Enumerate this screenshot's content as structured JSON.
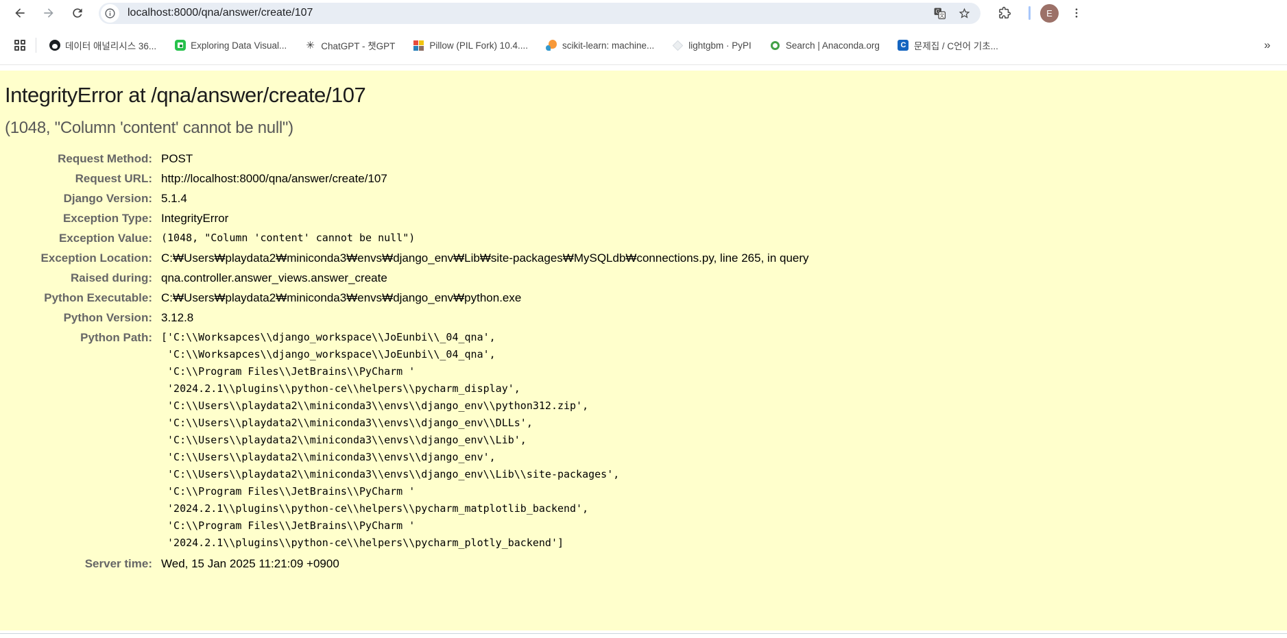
{
  "browser": {
    "url": "localhost:8000/qna/answer/create/107",
    "profile_initial": "E"
  },
  "bookmarks": {
    "overflow_chevron": "»",
    "items": [
      {
        "icon": "github-icon",
        "label": "데이터 애널리시스 36..."
      },
      {
        "icon": "data-visual-icon",
        "label": "Exploring Data Visual..."
      },
      {
        "icon": "chatgpt-icon",
        "label": "ChatGPT - 챗GPT"
      },
      {
        "icon": "pillow-icon",
        "label": "Pillow (PIL Fork) 10.4...."
      },
      {
        "icon": "scikit-learn-icon",
        "label": "scikit-learn: machine..."
      },
      {
        "icon": "lightgbm-icon",
        "label": "lightgbm · PyPI"
      },
      {
        "icon": "anaconda-icon",
        "label": "Search | Anaconda.org"
      },
      {
        "icon": "c-lang-icon",
        "label": "문제집 / C언어 기초..."
      }
    ]
  },
  "page": {
    "title": "IntegrityError at /qna/answer/create/107",
    "subtitle": "(1048, \"Column 'content' cannot be null\")",
    "summary_bg": "#ffffcc",
    "meta": {
      "rows": [
        {
          "label": "Request Method:",
          "value": "POST"
        },
        {
          "label": "Request URL:",
          "value": "http://localhost:8000/qna/answer/create/107"
        },
        {
          "label": "Django Version:",
          "value": "5.1.4"
        },
        {
          "label": "Exception Type:",
          "value": "IntegrityError"
        },
        {
          "label": "Exception Value:",
          "value": "(1048, \"Column 'content' cannot be null\")"
        },
        {
          "label": "Exception Location:",
          "value": "C:₩Users₩playdata2₩miniconda3₩envs₩django_env₩Lib₩site-packages₩MySQLdb₩connections.py, line 265, in query"
        },
        {
          "label": "Raised during:",
          "value": "qna.controller.answer_views.answer_create"
        },
        {
          "label": "Python Executable:",
          "value": "C:₩Users₩playdata2₩miniconda3₩envs₩django_env₩python.exe"
        },
        {
          "label": "Python Version:",
          "value": "3.12.8"
        },
        {
          "label": "Python Path:",
          "value": "['C:\\\\Worksapces\\\\django_workspace\\\\JoEunbi\\\\_04_qna',\n 'C:\\\\Worksapces\\\\django_workspace\\\\JoEunbi\\\\_04_qna',\n 'C:\\\\Program Files\\\\JetBrains\\\\PyCharm '\n '2024.2.1\\\\plugins\\\\python-ce\\\\helpers\\\\pycharm_display',\n 'C:\\\\Users\\\\playdata2\\\\miniconda3\\\\envs\\\\django_env\\\\python312.zip',\n 'C:\\\\Users\\\\playdata2\\\\miniconda3\\\\envs\\\\django_env\\\\DLLs',\n 'C:\\\\Users\\\\playdata2\\\\miniconda3\\\\envs\\\\django_env\\\\Lib',\n 'C:\\\\Users\\\\playdata2\\\\miniconda3\\\\envs\\\\django_env',\n 'C:\\\\Users\\\\playdata2\\\\miniconda3\\\\envs\\\\django_env\\\\Lib\\\\site-packages',\n 'C:\\\\Program Files\\\\JetBrains\\\\PyCharm '\n '2024.2.1\\\\plugins\\\\python-ce\\\\helpers\\\\pycharm_matplotlib_backend',\n 'C:\\\\Program Files\\\\JetBrains\\\\PyCharm '\n '2024.2.1\\\\plugins\\\\python-ce\\\\helpers\\\\pycharm_plotly_backend']"
        },
        {
          "label": "Server time:",
          "value": "Wed, 15 Jan 2025 11:21:09 +0900"
        }
      ]
    }
  }
}
